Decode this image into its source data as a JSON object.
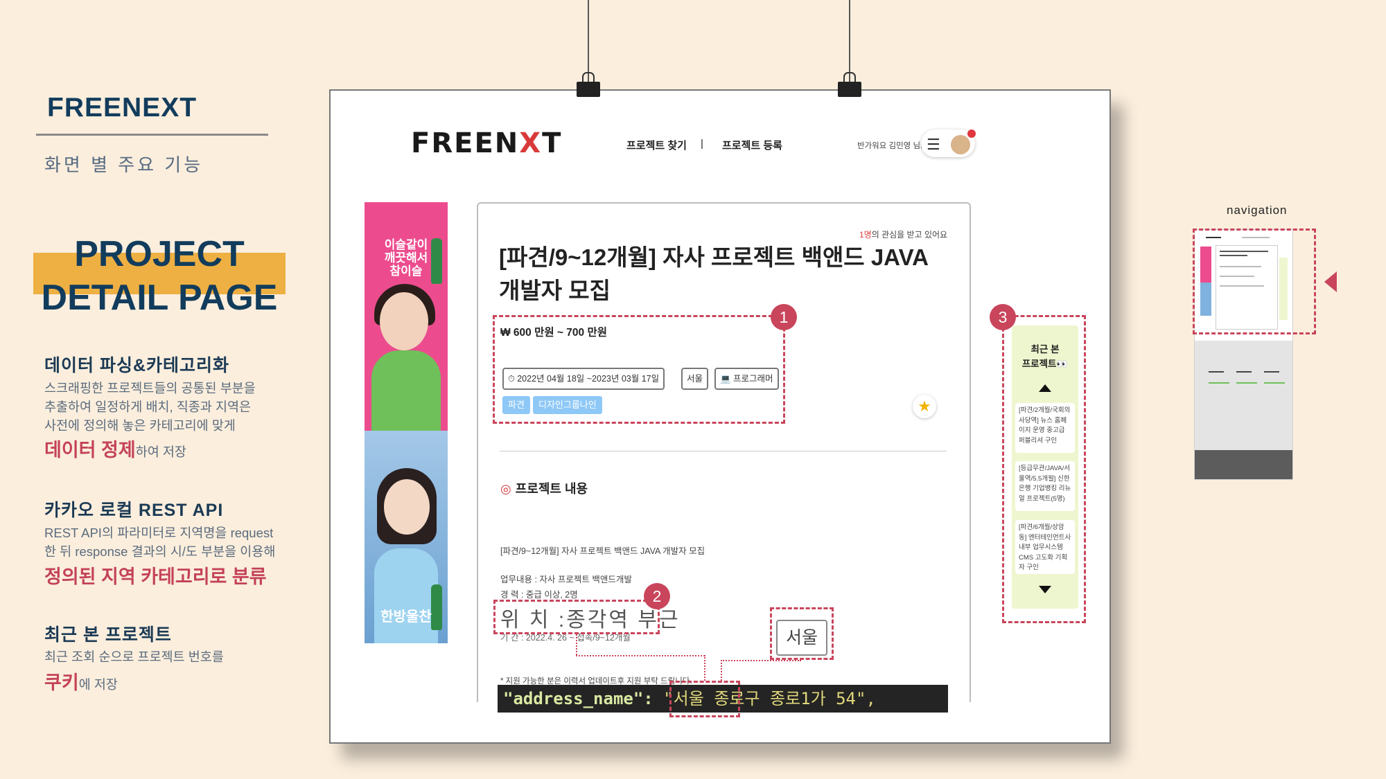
{
  "slide": {
    "brand": "FREENEXT",
    "subtitle": "화면 별 주요 기능",
    "title_line1": "PROJECT",
    "title_line2": "DETAIL PAGE"
  },
  "sections": [
    {
      "heading": "데이터 파싱&카테고리화",
      "lines": [
        "스크래핑한 프로젝트들의 공통된 부분을",
        "추출하여 일정하게 배치, 직종과 지역은",
        "사전에 정의해 놓은 카테고리에 맞게"
      ],
      "highlight": "데이터 정제",
      "after": "하여 저장"
    },
    {
      "heading": "카카오 로컬 REST API",
      "lines": [
        "REST API의 파라미터로 지역명을 request",
        "한 뒤 response 결과의 시/도 부분을 이용해"
      ],
      "highlight": "정의된 지역 카테고리로 분류",
      "after": ""
    },
    {
      "heading": "최근 본 프로젝트",
      "lines": [
        "최근 조회 순으로 프로젝트 번호를"
      ],
      "highlight": "쿠키",
      "after": "에 저장"
    }
  ],
  "site": {
    "logo_pre": "FREEN",
    "logo_x": "X",
    "logo_post": "T",
    "nav_find": "프로젝트 찾기",
    "nav_sep": "|",
    "nav_register": "프로젝트 등록",
    "greeting": "반가워요 김민영 님!",
    "menu_icon": "☰"
  },
  "ad": {
    "copy1": "이슬같이 깨끗해서 참이슬",
    "copy2": "한방울찬"
  },
  "project": {
    "interest_count": "1명",
    "interest_text": "의 관심을 받고 있어요",
    "title": "[파견/9~12개월] 자사 프로젝트 백앤드 JAVA 개발자 모집",
    "pay": "₩ 600 만원 ~ 700 만원",
    "period": "⏱ 2022년 04월 18일 ~2023년 03월 17일",
    "region": "서울",
    "job": "💻 프로그래머",
    "chips": [
      "파견",
      "디자인그룹나인"
    ],
    "star": "★",
    "content_heading": "프로젝트 내용",
    "content_icon": "◎",
    "body_title": "[파견/9~12개월] 자사 프로젝트 백앤드 JAVA 개발자 모집",
    "duty": "업무내용 : 자사 프로젝트 백앤드개발",
    "career": "경 력 : 중급 이상, 2명",
    "location": "위 치 :종각역 부근",
    "term": "기 간 : 2022.4. 26 ~ 접속/9~12개월",
    "notice": "* 지원 가능한 분은 이력서 업데이트후 지원 부탁 드립니다.",
    "seoul_box": "서울",
    "code_key": "\"address_name\":",
    "code_city": "\"서울",
    "code_rest": "종로구 종로1가 54\","
  },
  "annotations": [
    "1",
    "2",
    "3"
  ],
  "recent": {
    "title_line1": "최근 본",
    "title_line2": "프로젝트👀",
    "items": [
      "[파견/2개월/국회의사당역] 뉴스 홈페이지 운영 중고급 퍼블리셔 구인",
      "[등급무관/JAVA/서울역/5.5개월] 신한은행 기업뱅킹 리뉴얼 프로젝트(5명)",
      "[파견/6개월/상암동] 엔터테인먼트사 내부 업무시스템 CMS 고도화 기획자 구인"
    ]
  },
  "navigation": {
    "label": "navigation"
  }
}
